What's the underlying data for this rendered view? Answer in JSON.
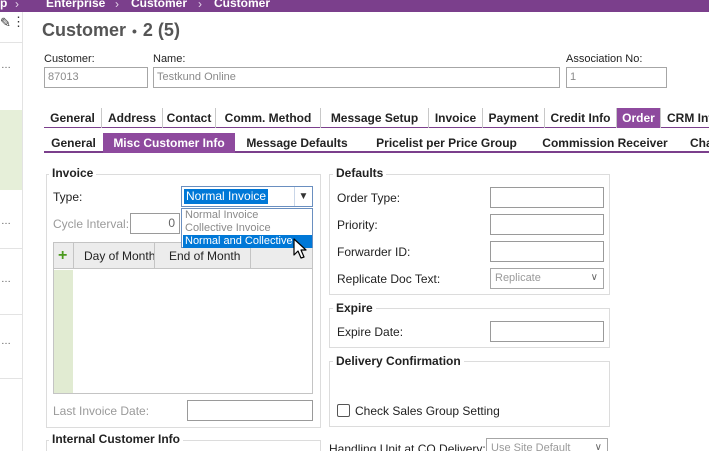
{
  "breadcrumb": [
    "p",
    "Enterprise",
    "Customer",
    "Customer"
  ],
  "header": {
    "title": "Customer",
    "record": "2 (5)"
  },
  "fields": {
    "customer_label": "Customer:",
    "customer_value": "87013",
    "name_label": "Name:",
    "name_value": "Testkund Online",
    "assoc_label": "Association No:",
    "assoc_value": "1"
  },
  "tabs_main": [
    {
      "label": "General"
    },
    {
      "label": "Address"
    },
    {
      "label": "Contact"
    },
    {
      "label": "Comm. Method"
    },
    {
      "label": "Message Setup"
    },
    {
      "label": "Invoice"
    },
    {
      "label": "Payment"
    },
    {
      "label": "Credit Info"
    },
    {
      "label": "Order"
    },
    {
      "label": "CRM Info"
    }
  ],
  "tabs_sub": [
    {
      "label": "General"
    },
    {
      "label": "Misc Customer Info"
    },
    {
      "label": "Message Defaults"
    },
    {
      "label": "Pricelist per Price Group"
    },
    {
      "label": "Commission Receiver"
    },
    {
      "label": "Cha"
    }
  ],
  "invoice": {
    "title": "Invoice",
    "type_label": "Type:",
    "type_value": "Normal Invoice",
    "options": [
      "Normal Invoice",
      "Collective Invoice",
      "Normal and Collective"
    ],
    "highlighted_option": "Normal and Collective",
    "cycle_label": "Cycle Interval:",
    "cycle_value": "0",
    "grid_headers": [
      "Day of Month",
      "End of Month"
    ],
    "last_invoice_label": "Last Invoice Date:",
    "last_invoice_value": ""
  },
  "internal": {
    "title": "Internal Customer Info"
  },
  "defaults": {
    "title": "Defaults",
    "order_type_label": "Order Type:",
    "order_type_value": "",
    "priority_label": "Priority:",
    "priority_value": "",
    "forwarder_label": "Forwarder ID:",
    "forwarder_value": "",
    "replicate_label": "Replicate Doc Text:",
    "replicate_value": "Replicate"
  },
  "expire": {
    "title": "Expire",
    "date_label": "Expire Date:",
    "date_value": ""
  },
  "delivery": {
    "title": "Delivery Confirmation",
    "check_label": "Check Sales Group Setting"
  },
  "handling": {
    "label": "Handling Unit at CO Delivery:",
    "value": "Use Site Default"
  },
  "colors": {
    "brand": "#7b3f8c",
    "active_tab": "#8e4a9e",
    "selection": "#0078d7",
    "grid_gutter": "#e1ebd2"
  }
}
